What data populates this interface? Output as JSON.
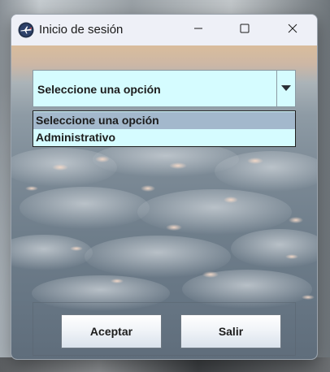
{
  "window": {
    "title": "Inicio de sesión",
    "icon": "airplane-app-icon",
    "controls": [
      "minimize-icon",
      "maximize-icon",
      "close-icon"
    ]
  },
  "combo": {
    "selected": "Seleccione una opción",
    "arrow_icon": "triangle-down-icon",
    "background": "#d5fcff"
  },
  "dropdown": {
    "options": [
      "Seleccione una opción",
      "Administrativo"
    ],
    "highlighted_index": 0,
    "highlight_color": "#a3b8cc"
  },
  "buttons": {
    "accept_label": "Aceptar",
    "exit_label": "Salir"
  }
}
